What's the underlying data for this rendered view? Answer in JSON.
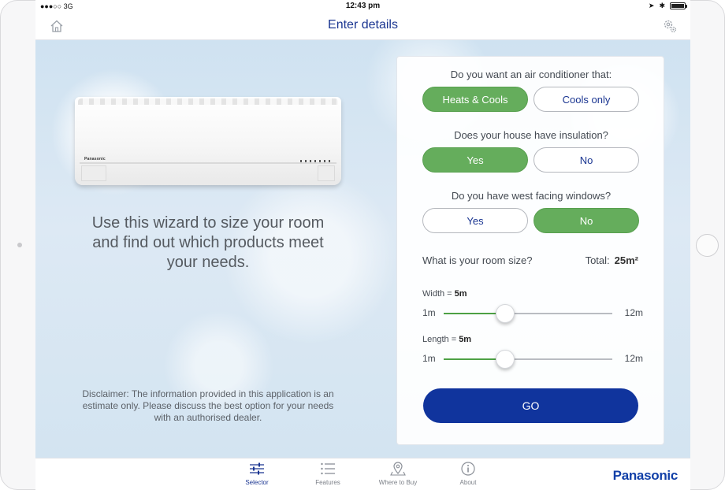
{
  "status_bar": {
    "signal": "●●●○○ 3G",
    "time": "12:43 pm"
  },
  "navbar": {
    "title": "Enter details",
    "home_icon": "home-icon",
    "settings_icon": "gear-icon"
  },
  "product": {
    "brand_on_unit": "Panasonic"
  },
  "intro": {
    "wizard_text": "Use this wizard to size your room and find out which products meet your needs.",
    "disclaimer": "Disclaimer: The information provided in this application is an estimate only. Please discuss the best option for your needs with an authorised dealer."
  },
  "form": {
    "q1": {
      "label": "Do you want an air conditioner that:",
      "options": [
        "Heats & Cools",
        "Cools only"
      ],
      "selected": "Heats & Cools"
    },
    "q2": {
      "label": "Does your house have insulation?",
      "options": [
        "Yes",
        "No"
      ],
      "selected": "Yes"
    },
    "q3": {
      "label": "Do you have west facing windows?",
      "options": [
        "Yes",
        "No"
      ],
      "selected": "No"
    },
    "room_size": {
      "label": "What is your room size?",
      "total_label": "Total:",
      "total_value": "25m²"
    },
    "width": {
      "label": "Width = ",
      "value_text": "5m",
      "min": "1m",
      "max": "12m",
      "value": 5,
      "range": [
        1,
        12
      ]
    },
    "length": {
      "label": "Length = ",
      "value_text": "5m",
      "min": "1m",
      "max": "12m",
      "value": 5,
      "range": [
        1,
        12
      ]
    },
    "go_label": "GO"
  },
  "tabs": [
    {
      "label": "Selector",
      "icon": "sliders-icon",
      "active": true
    },
    {
      "label": "Features",
      "icon": "list-icon",
      "active": false
    },
    {
      "label": "Where to Buy",
      "icon": "map-pin-icon",
      "active": false
    },
    {
      "label": "About",
      "icon": "info-icon",
      "active": false
    }
  ],
  "brand": "Panasonic",
  "colors": {
    "accent_blue": "#1a3591",
    "go_blue": "#10349d",
    "selected_green": "#65ad5c",
    "slider_green": "#4da144"
  }
}
